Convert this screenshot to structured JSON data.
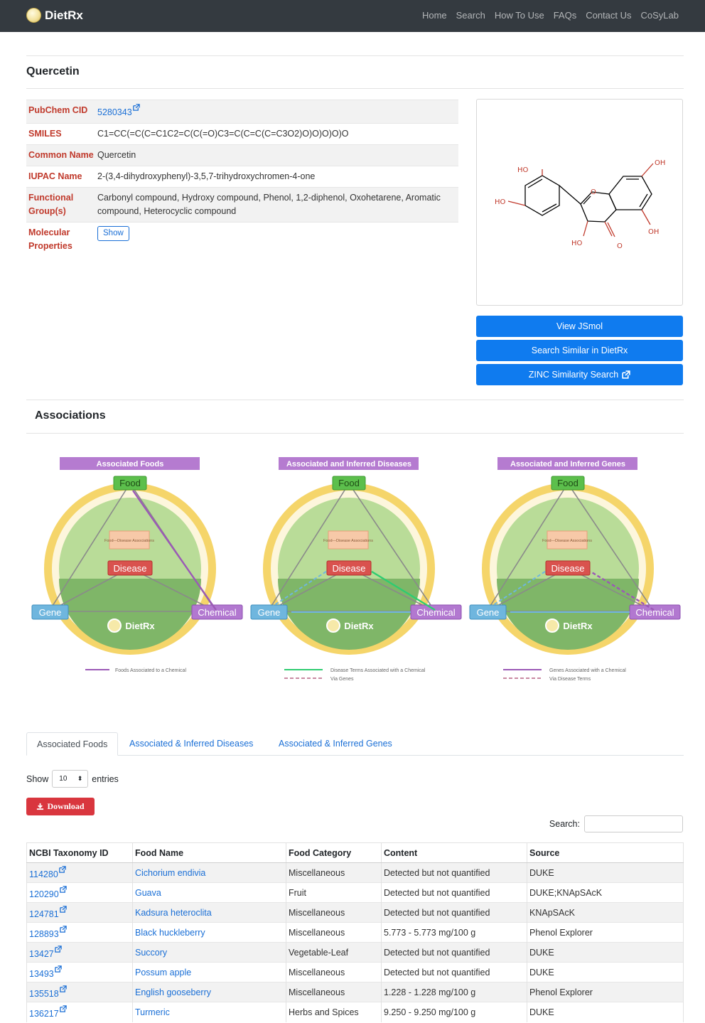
{
  "nav": {
    "brand": "DietRx",
    "links": [
      "Home",
      "Search",
      "How To Use",
      "FAQs",
      "Contact Us",
      "CoSyLab"
    ]
  },
  "compound": {
    "title": "Quercetin",
    "rows": [
      {
        "label": "PubChem CID",
        "value": "5280343",
        "link": true
      },
      {
        "label": "SMILES",
        "value": "C1=CC(=C(C=C1C2=C(C(=O)C3=C(C=C(C=C3O2)O)O)O)O)O"
      },
      {
        "label": "Common Name",
        "value": "Quercetin"
      },
      {
        "label": "IUPAC Name",
        "value": "2-(3,4-dihydroxyphenyl)-3,5,7-trihydroxychromen-4-one"
      },
      {
        "label": "Functional Group(s)",
        "value": "Carbonyl compound, Hydroxy compound, Phenol, 1,2-diphenol, Oxohetarene, Aromatic compound, Heterocyclic compound"
      },
      {
        "label": "Molecular Properties",
        "button": "Show"
      }
    ],
    "structure_labels": {
      "ho1": "HO",
      "ho2": "HO",
      "oh1": "OH",
      "oh2": "OH",
      "ho3": "HO",
      "o_carbonyl": "O",
      "o_ring": "O"
    }
  },
  "actions": {
    "view_jsmol": "View JSmol",
    "search_similar": "Search Similar in DietRx",
    "zinc": "ZINC Similarity Search"
  },
  "associations": {
    "title": "Associations",
    "diagrams": [
      {
        "banner": "Associated Foods",
        "legend": [
          "Foods Associated to a Chemical"
        ]
      },
      {
        "banner": "Associated and Inferred Diseases",
        "legend": [
          "Disease Terms Associated with a Chemical",
          "Via Genes"
        ]
      },
      {
        "banner": "Associated and Inferred Genes",
        "legend": [
          "Genes Associated with a Chemical",
          "Via Disease Terms"
        ]
      }
    ],
    "node_labels": {
      "food": "Food",
      "disease": "Disease",
      "gene": "Gene",
      "chemical": "Chemical",
      "logo": "DietRx",
      "text_mining": "Food—Disease Associations"
    }
  },
  "tabs": [
    "Associated Foods",
    "Associated & Inferred Diseases",
    "Associated & Inferred Genes"
  ],
  "table_controls": {
    "show": "Show",
    "page_size": "10",
    "entries": "entries",
    "download": "Download",
    "search_label": "Search:"
  },
  "foods": {
    "columns": [
      "NCBI Taxonomy ID",
      "Food Name",
      "Food Category",
      "Content",
      "Source"
    ],
    "rows": [
      [
        "114280",
        "Cichorium endivia",
        "Miscellaneous",
        "Detected but not quantified",
        "DUKE"
      ],
      [
        "120290",
        "Guava",
        "Fruit",
        "Detected but not quantified",
        "DUKE;KNApSAcK"
      ],
      [
        "124781",
        "Kadsura heteroclita",
        "Miscellaneous",
        "Detected but not quantified",
        "KNApSAcK"
      ],
      [
        "128893",
        "Black huckleberry",
        "Miscellaneous",
        "5.773 - 5.773 mg/100 g",
        "Phenol Explorer"
      ],
      [
        "13427",
        "Succory",
        "Vegetable-Leaf",
        "Detected but not quantified",
        "DUKE"
      ],
      [
        "13493",
        "Possum apple",
        "Miscellaneous",
        "Detected but not quantified",
        "DUKE"
      ],
      [
        "135518",
        "English gooseberry",
        "Miscellaneous",
        "1.228 - 1.228 mg/100 g",
        "Phenol Explorer"
      ],
      [
        "136217",
        "Turmeric",
        "Herbs and Spices",
        "9.250 - 9.250 mg/100 g",
        "DUKE"
      ]
    ]
  },
  "colors": {
    "navbar": "#343a40",
    "primary": "#0f7bef",
    "danger": "#d9363e",
    "label": "#c0392b",
    "link": "#1a6fd6"
  }
}
